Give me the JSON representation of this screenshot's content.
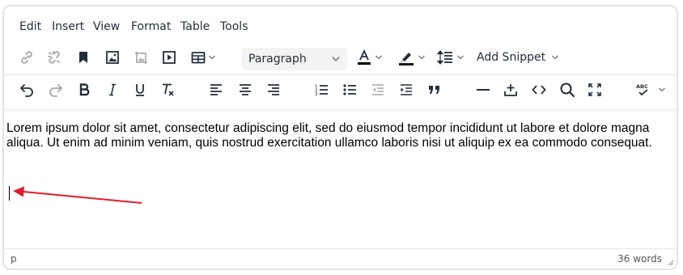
{
  "menubar": {
    "items": [
      "Edit",
      "Insert",
      "View",
      "Format",
      "Table",
      "Tools"
    ]
  },
  "toolbar1": {
    "block_format": "Paragraph",
    "snippet_label": "Add Snippet",
    "text_color_underline": "#000000",
    "highlight_underline": "#1a1a1a"
  },
  "content": {
    "paragraph": "Lorem ipsum dolor sit amet, consectetur adipiscing elit, sed do eiusmod tempor incididunt ut labore et dolore magna aliqua. Ut enim ad minim veniam, quis nostrud exercitation ullamco laboris nisi ut aliquip ex ea commodo consequat."
  },
  "annotation": {
    "arrow_color": "#e11d2a"
  },
  "statusbar": {
    "path": "p",
    "word_count": "36 words"
  },
  "colors": {
    "icon": "#222f3e",
    "disabled_icon": "#a3a7ad",
    "border": "#e3e3e3"
  }
}
